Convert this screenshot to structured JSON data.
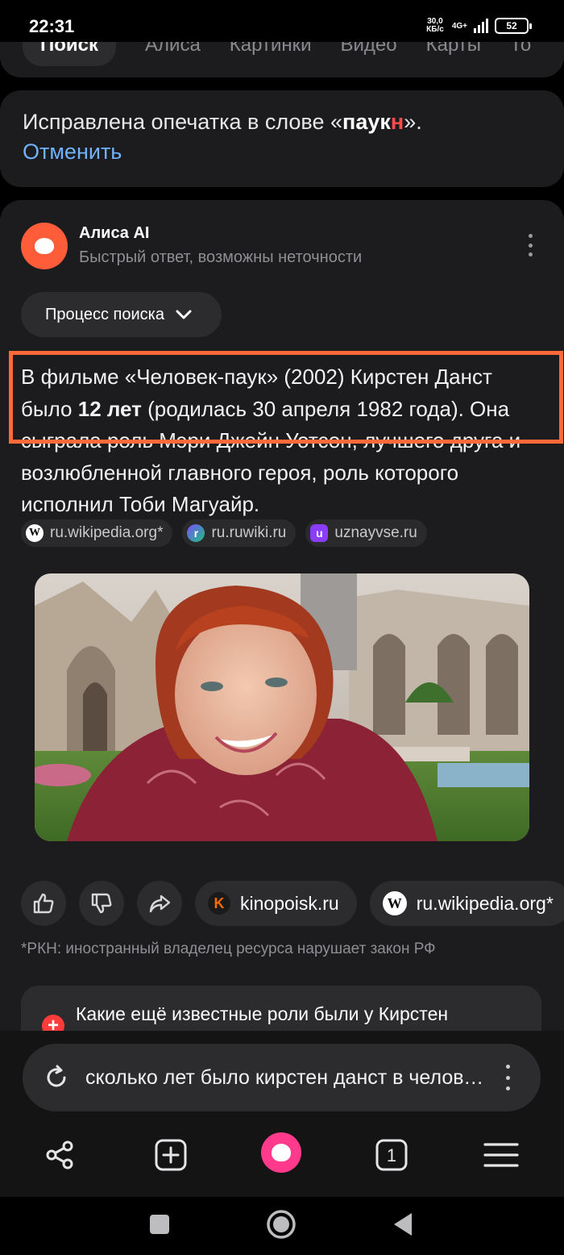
{
  "status_bar": {
    "time": "22:31",
    "net_speed_value": "30,0",
    "net_speed_unit": "КБ/с",
    "network": "4G+",
    "battery": "52"
  },
  "tabs": [
    "Поиск",
    "Алиса",
    "Картинки",
    "Видео",
    "Карты",
    "То"
  ],
  "typo": {
    "prefix": "Исправлена опечатка в слове «",
    "word_main": "паук",
    "word_error": "н",
    "suffix": "».",
    "cancel": "Отменить"
  },
  "alisa": {
    "name": "Алиса AI",
    "subtitle": "Быстрый ответ, возможны неточности",
    "process_button": "Процесс поиска"
  },
  "answer": {
    "part1": "В фильме «Человек-паук» (2002) Кирстен Данст было ",
    "bold": "12 лет",
    "part2": " (родилась 30 апреля 1982 года). Она сыграла роль Мэри Джейн Уотсон, лучшего друга и возлюбленной главного героя, роль которого исполнил Тоби Магуайр."
  },
  "inline_sources": [
    {
      "label": "ru.wikipedia.org*",
      "icon": "wikipedia-icon"
    },
    {
      "label": "ru.ruwiki.ru",
      "icon": "ruwiki-icon"
    },
    {
      "label": "uznayvse.ru",
      "icon": "uznayvse-icon"
    }
  ],
  "source_buttons": [
    {
      "label": "kinopoisk.ru",
      "icon": "kinopoisk-icon"
    },
    {
      "label": "ru.wikipedia.org*",
      "icon": "wikipedia-icon"
    }
  ],
  "rkn_note": "*РКН: иностранный владелец ресурса нарушает закон РФ",
  "followup": "Какие ещё известные роли были у Кирстен Данст?",
  "query": "сколько лет было кирстен данст в человеке пауке",
  "tab_count": "1",
  "colors": {
    "background": "#000000",
    "card": "#1c1c1e",
    "accent_link": "#6fb2ff",
    "error_letter": "#ff4b4b",
    "highlight_border": "#ff6a3a",
    "alisa_logo": "#ff5c3a",
    "alisa_center": "#ff3a8c"
  }
}
